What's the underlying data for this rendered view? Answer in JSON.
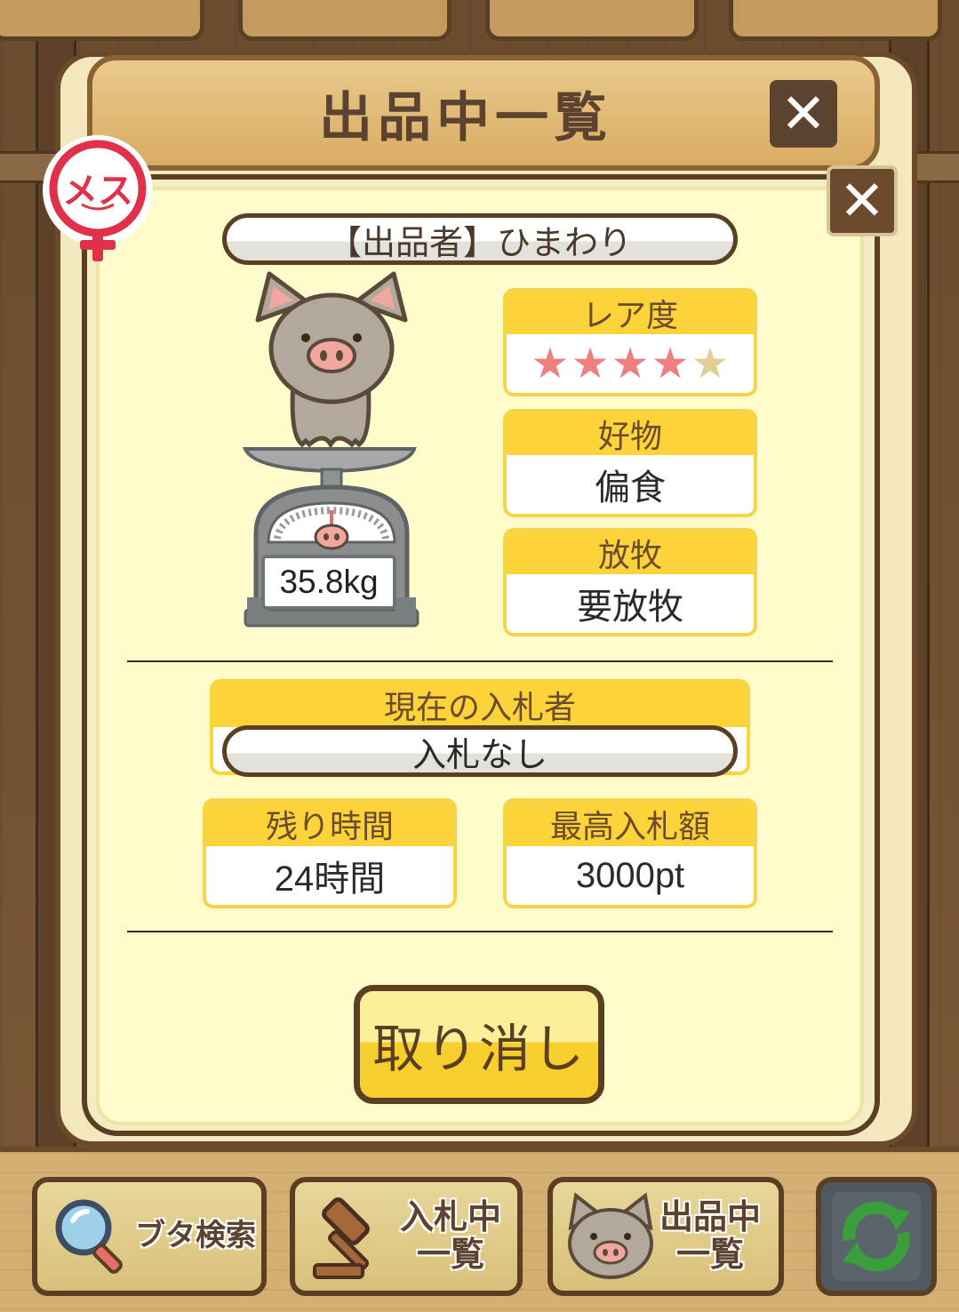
{
  "header": {
    "title": "出品中一覧",
    "close_symbol": "✕"
  },
  "card": {
    "close_symbol": "✕"
  },
  "gender": {
    "label": "メス",
    "color": "#e0304a"
  },
  "seller": {
    "label": "【出品者】ひまわり"
  },
  "pig": {
    "weight": "35.8kg"
  },
  "rarity": {
    "label": "レア度",
    "stars_total": 5,
    "stars_filled": 4,
    "star_glyph": "★"
  },
  "favorite": {
    "label": "好物",
    "value": "偏食"
  },
  "grazing": {
    "label": "放牧",
    "value": "要放牧"
  },
  "bidder": {
    "label": "現在の入札者",
    "value": "入札なし"
  },
  "remaining": {
    "label": "残り時間",
    "value": "24時間"
  },
  "highest_bid": {
    "label": "最高入札額",
    "value": "3000pt"
  },
  "cancel_button": {
    "label": "取り消し"
  },
  "nav": {
    "search": {
      "label": "ブタ検索",
      "icon": "magnifier-icon"
    },
    "bidding": {
      "label_line1": "入札中",
      "label_line2": "一覧",
      "icon": "gavel-icon"
    },
    "listing": {
      "label_line1": "出品中",
      "label_line2": "一覧",
      "icon": "pig-face-icon"
    },
    "refresh": {
      "icon": "refresh-icon"
    }
  },
  "colors": {
    "accent_yellow": "#fcd43a",
    "frame_brown": "#5b3f22",
    "star_on": "#ec8080",
    "star_off": "#e2cf96"
  }
}
